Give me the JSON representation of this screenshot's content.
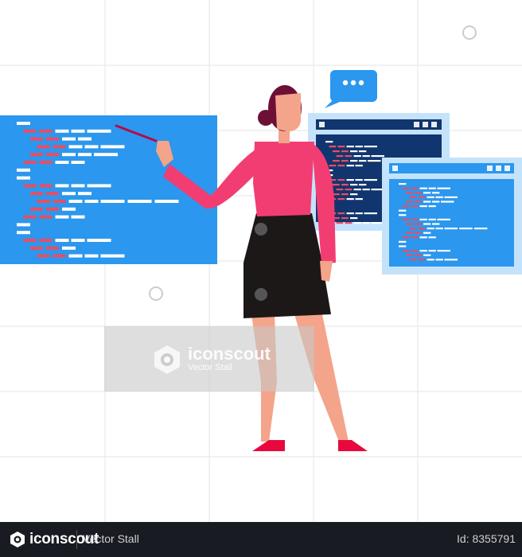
{
  "illustration": {
    "subject": "woman presenting code on screens",
    "colors": {
      "screen_blue": "#2b97ee",
      "dark_navy": "#11356e",
      "light_frame": "#c4e3fb",
      "code_red": "#e94d62",
      "code_white": "#ffffff",
      "sweater_pink": "#f23d73",
      "skirt_black": "#1d1818",
      "skin": "#f4a48a",
      "hair": "#6e0f36",
      "shoes": "#e8083e",
      "pointer": "#b60b48"
    },
    "chat_bubble_icon": "speech-bubble-ellipsis-icon"
  },
  "watermark": {
    "brand": "iconscout",
    "author": "Vector Stall"
  },
  "footer": {
    "brand": "iconscout",
    "author": "Vector Stall",
    "id_text": "Id: 8355791"
  }
}
